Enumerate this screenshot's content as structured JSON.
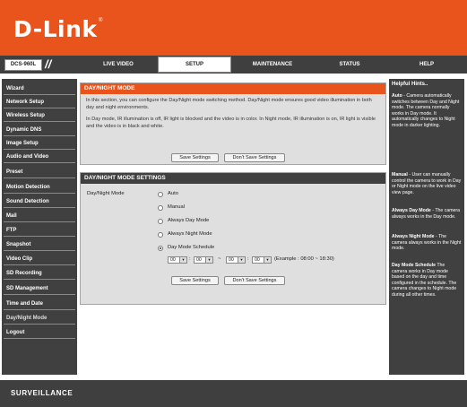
{
  "brand": {
    "logo": "D-Link",
    "registered": "®"
  },
  "nav": {
    "model": "DCS-960L",
    "tabs": [
      {
        "label": "LIVE VIDEO"
      },
      {
        "label": "SETUP"
      },
      {
        "label": "MAINTENANCE"
      },
      {
        "label": "STATUS"
      },
      {
        "label": "HELP"
      }
    ],
    "active_tab": "SETUP"
  },
  "sidebar": {
    "items": [
      {
        "label": "Wizard"
      },
      {
        "label": "Network Setup"
      },
      {
        "label": "Wireless Setup"
      },
      {
        "label": "Dynamic DNS"
      },
      {
        "label": "Image Setup"
      },
      {
        "label": "Audio and Video"
      },
      {
        "label": "Preset"
      },
      {
        "label": "Motion Detection"
      },
      {
        "label": "Sound Detection"
      },
      {
        "label": "Mail"
      },
      {
        "label": "FTP"
      },
      {
        "label": "Snapshot"
      },
      {
        "label": "Video Clip"
      },
      {
        "label": "SD Recording"
      },
      {
        "label": "SD Management"
      },
      {
        "label": "Time and Date"
      },
      {
        "label": "Day/Night Mode"
      },
      {
        "label": "Logout"
      }
    ],
    "active": "Day/Night Mode"
  },
  "intro": {
    "title": "DAY/NIGHT MODE",
    "paragraph1": "In this section, you can configure the Day/Night mode switching method. Day/Night mode ensures good video illumination in both day and night environments.",
    "paragraph2": "In Day mode, IR illumination is off, IR light is blocked and the video is in color. In Night mode, IR illumination is on, IR light is visible and the video is in black and white.",
    "save_label": "Save Settings",
    "dont_save_label": "Don't Save Settings"
  },
  "settings": {
    "title": "DAY/NIGHT MODE SETTINGS",
    "field_label": "Day/Night Mode",
    "options": [
      {
        "label": "Auto",
        "selected": false
      },
      {
        "label": "Manual",
        "selected": false
      },
      {
        "label": "Always Day Mode",
        "selected": false
      },
      {
        "label": "Always Night Mode",
        "selected": false
      },
      {
        "label": "Day Mode Schedule",
        "selected": true
      }
    ],
    "schedule": {
      "start_hour": "00",
      "start_min": "00",
      "end_hour": "00",
      "end_min": "00",
      "colon": ":",
      "tilde": "~",
      "example": "(Example : 08:00 ~ 18:30)"
    },
    "save_label": "Save Settings",
    "dont_save_label": "Don't Save Settings"
  },
  "help": {
    "title": "Helpful Hints..",
    "blocks": [
      {
        "heading": "Auto",
        "text": " - Camera automatically switches between Day and Night mode. The camera normally works in Day mode. It automatically changes to Night mode in darker lighting."
      },
      {
        "heading": "Manual",
        "text": " - User can manually control the camera to work in Day or Night mode on the live video view page."
      },
      {
        "heading": "Always Day Mode",
        "text": " - The camera always works in the Day mode."
      },
      {
        "heading": "Always Night Mode",
        "text": " - The camera always works in the Night mode."
      },
      {
        "heading": "Day Mode Schedule",
        "text": " The camera works in Day mode based on the day and time configured in the schedule. The camera changes to Night mode during all other times."
      }
    ]
  },
  "footer": {
    "text": "SURVEILLANCE"
  }
}
